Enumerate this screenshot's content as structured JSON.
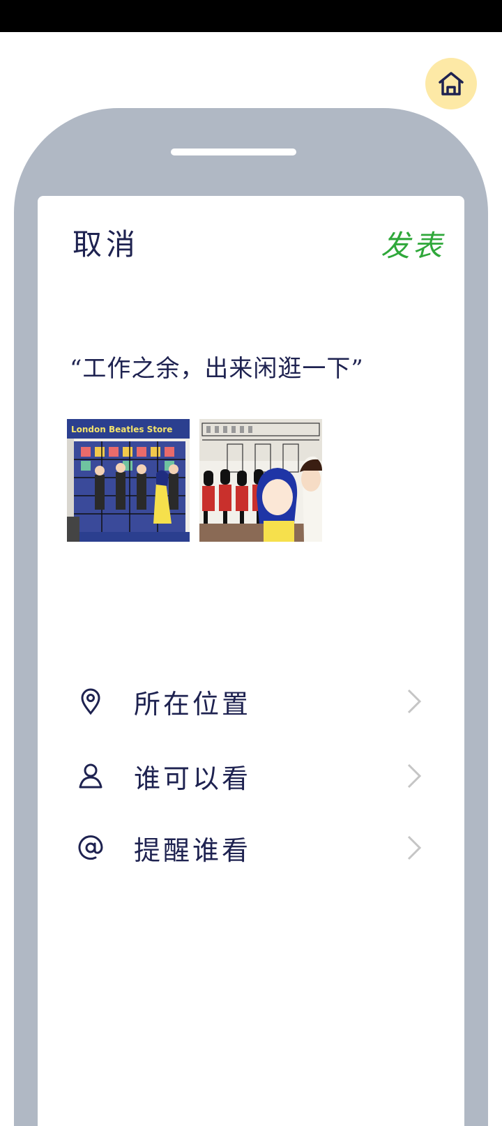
{
  "header": {
    "cancel_label": "取消",
    "publish_label": "发表"
  },
  "post": {
    "text": "“工作之余，出来闲逛一下”",
    "photos": [
      {
        "sign_text": "London Beatles Store"
      },
      {
        "sign_text": ""
      }
    ]
  },
  "menu": {
    "items": [
      {
        "icon": "location-pin-icon",
        "label": "所在位置"
      },
      {
        "icon": "person-icon",
        "label": "谁可以看"
      },
      {
        "icon": "at-sign-icon",
        "label": "提醒谁看"
      }
    ]
  },
  "colors": {
    "frame": "#b0b8c4",
    "ink": "#1e2250",
    "publish": "#2fa83a",
    "home_bg": "#fde9a6"
  }
}
